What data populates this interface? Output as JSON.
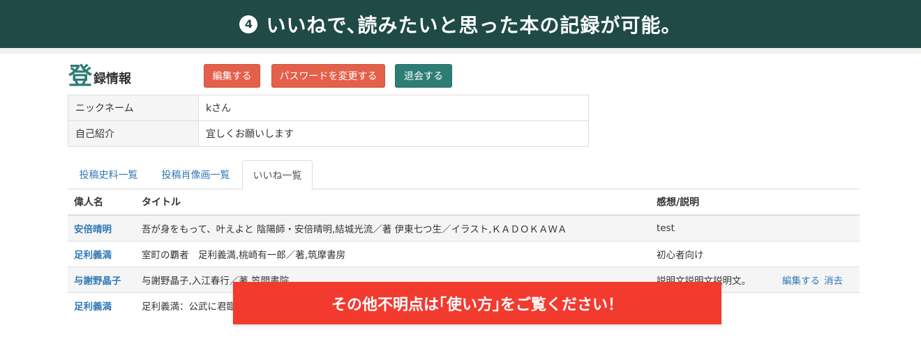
{
  "banner": {
    "number": "4",
    "text": "いいねで､読みたいと思った本の記録が可能。"
  },
  "heading": {
    "first_char": "登",
    "rest": "録情報"
  },
  "buttons": {
    "edit": "編集する",
    "password": "パスワードを変更する",
    "leave": "退会する"
  },
  "profile": [
    {
      "key": "ニックネーム",
      "value": "kさん"
    },
    {
      "key": "自己紹介",
      "value": "宜しくお願いします"
    }
  ],
  "tabs": [
    {
      "label": "投稿史料一覧"
    },
    {
      "label": "投稿肖像画一覧"
    },
    {
      "label": "いいね一覧",
      "active": true
    }
  ],
  "likes_table": {
    "headers": {
      "person": "偉人名",
      "title": "タイトル",
      "impression": "感想/説明"
    },
    "rows": [
      {
        "person": "安倍晴明",
        "title": "吾が身をもって、叶えよと 陰陽師・安倍晴明,結城光流／著 伊東七つ生／イラスト,ＫＡＤＯＫＡＷＡ",
        "impression": "test"
      },
      {
        "person": "足利義満",
        "title": "室町の覇者　足利義満,桃崎有一郎／著,筑摩書房",
        "impression": "初心者向け"
      },
      {
        "person": "与謝野晶子",
        "title": "与謝野晶子,入江春行／著,笠間書院",
        "impression": "説明文説明文説明文。",
        "edit": "編集する",
        "delete": "消去"
      },
      {
        "person": "足利義満",
        "title": "足利義満：公武に君臨",
        "impression": ""
      }
    ]
  },
  "overlay": {
    "text": "その他不明点は｢使い方｣をご覧ください！"
  },
  "colors": {
    "banner": "#1f4a45",
    "accent": "#2e7d74",
    "danger": "#e4604a",
    "link": "#337ab7",
    "overlay": "#f23a2f"
  }
}
